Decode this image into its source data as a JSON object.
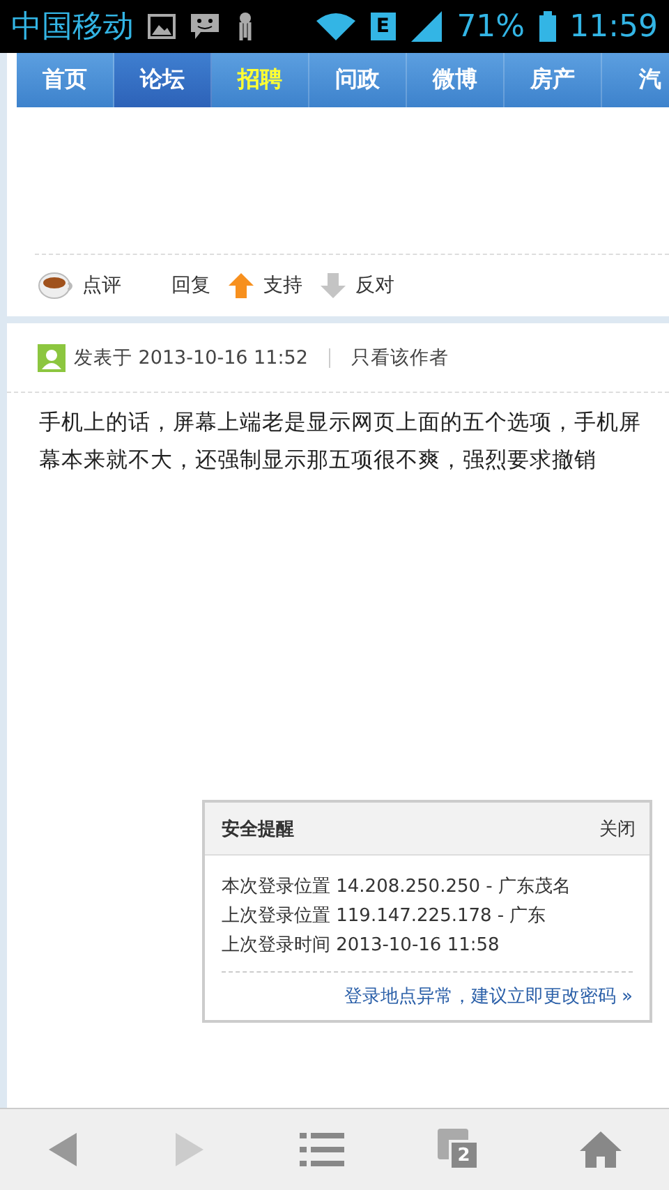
{
  "status_bar": {
    "carrier": "中国移动",
    "network": "E",
    "battery": "71%",
    "time": "11:59"
  },
  "nav": [
    {
      "label": "首页",
      "selected": false,
      "highlighted": false
    },
    {
      "label": "论坛",
      "selected": true,
      "highlighted": false
    },
    {
      "label": "招聘",
      "selected": false,
      "highlighted": true
    },
    {
      "label": "问政",
      "selected": false,
      "highlighted": false
    },
    {
      "label": "微博",
      "selected": false,
      "highlighted": false
    },
    {
      "label": "房产",
      "selected": false,
      "highlighted": false
    },
    {
      "label": "汽",
      "selected": false,
      "highlighted": false
    }
  ],
  "actions": [
    {
      "kind": "comment",
      "label": "点评"
    },
    {
      "kind": "reply",
      "label": "回复"
    },
    {
      "kind": "up",
      "label": "支持"
    },
    {
      "kind": "down",
      "label": "反对"
    }
  ],
  "post": {
    "meta": "发表于 2013-10-16 11:52",
    "author_only": "只看该作者",
    "body": [
      "手机上的话，屏幕上端老是显示网页上面的五个选项，手机屏",
      "幕本来就不大，还强制显示那五项很不爽，强烈要求撤销"
    ]
  },
  "security_popup": {
    "title": "安全提醒",
    "close": "关闭",
    "lines": [
      "本次登录位置 14.208.250.250 - 广东茂名",
      "上次登录位置 119.147.225.178 - 广东",
      "上次登录时间 2013-10-16 11:58"
    ],
    "link": "登录地点异常，建议立即更改密码 »"
  },
  "toolbar": {
    "tab_count": "2"
  }
}
